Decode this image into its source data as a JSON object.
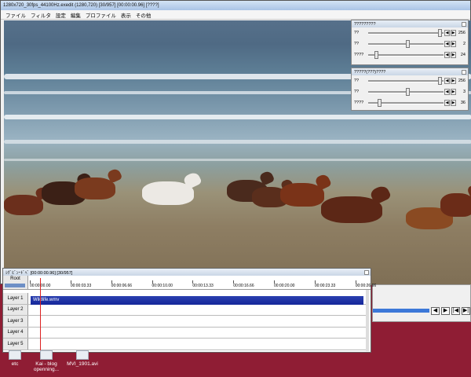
{
  "window": {
    "title": "1280x720_30fps_44100Hz.exedit (1280,720)  [30/957]  [00:00:00.96]  [????]"
  },
  "menu": [
    "ファイル",
    "フィルタ",
    "設定",
    "編集",
    "プロファイル",
    "表示",
    "その他"
  ],
  "panel_top": {
    "title": "?????????",
    "rows": [
      {
        "label": "??",
        "value": "256",
        "level": 0.93
      },
      {
        "label": "??",
        "value": "2",
        "level": 0.5
      },
      {
        "label": "????",
        "value": "24",
        "level": 0.08
      }
    ]
  },
  "panel_bottom": {
    "title": "?????(???)????",
    "rows": [
      {
        "label": "??",
        "value": "256",
        "level": 0.93
      },
      {
        "label": "??",
        "value": "3",
        "level": 0.5
      },
      {
        "label": "????",
        "value": "36",
        "level": 0.12
      }
    ]
  },
  "timeline": {
    "title": "ｼｸﾞﾋﾞﾝｰﾄﾞﾍﾞ [00:00:00.96]  [30/957]",
    "root_label": "Root",
    "ticks": [
      "00:00:00.00",
      "00:00:03.33",
      "00:00:06.66",
      "00:00:10.00",
      "00:00:13.33",
      "00:00:16.66",
      "00:00:20.00",
      "00:00:23.33",
      "00:00:26.66"
    ],
    "layers": [
      "Layer 1",
      "Layer 2",
      "Layer 3",
      "Layer 4",
      "Layer 5"
    ],
    "clip_label": "Wildlife.wmv"
  },
  "player": {
    "buttons": [
      "◀",
      "▶",
      "|◀",
      "▶|"
    ]
  },
  "desktop_icons": [
    {
      "label": "etc"
    },
    {
      "label": "Kai - blog openning..."
    },
    {
      "label": "MVI_1901.avi"
    }
  ]
}
